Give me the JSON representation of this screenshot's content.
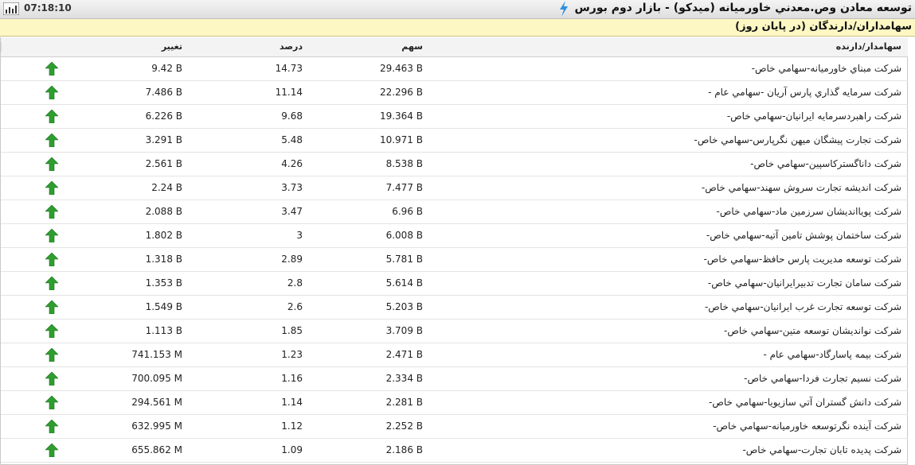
{
  "header": {
    "time": "07:18:10",
    "title": "توسعه معادن وص.معدني خاورميانه (ميدكو) - بازار دوم بورس",
    "icons": {
      "left": "bar-chart-icon",
      "title": "lightning-bolt-icon"
    }
  },
  "section": {
    "title": "سهامداران/دارندگان (در پایان روز)",
    "background": "#fdf7c3"
  },
  "table": {
    "columns": {
      "holder": "سهامدار/دارنده",
      "shares": "سهم",
      "percent": "درصد",
      "change": "تغییر"
    },
    "trend_color": "#2e9e2e",
    "rows": [
      {
        "holder": "شركت مبناي خاورميانه-سهامي خاص-",
        "shares": "29.463 B",
        "percent": "14.73",
        "change": "9.42 B",
        "trend": "up"
      },
      {
        "holder": "شركت سرمايه گذاري پارس آريان -سهامي عام -",
        "shares": "22.296 B",
        "percent": "11.14",
        "change": "7.486 B",
        "trend": "up"
      },
      {
        "holder": "شركت راهبردسرمايه ايرانيان-سهامي خاص-",
        "shares": "19.364 B",
        "percent": "9.68",
        "change": "6.226 B",
        "trend": "up"
      },
      {
        "holder": "شركت تجارت پيشگان ميهن نگرپارس-سهامي خاص-",
        "shares": "10.971 B",
        "percent": "5.48",
        "change": "3.291 B",
        "trend": "up"
      },
      {
        "holder": "شركت داناگستركاسپين-سهامي خاص-",
        "shares": "8.538 B",
        "percent": "4.26",
        "change": "2.561 B",
        "trend": "up"
      },
      {
        "holder": "شركت انديشه تجارت سروش سهند-سهامي خاص-",
        "shares": "7.477 B",
        "percent": "3.73",
        "change": "2.24 B",
        "trend": "up"
      },
      {
        "holder": "شركت پوياانديشان سرزمين ماد-سهامي خاص-",
        "shares": "6.96 B",
        "percent": "3.47",
        "change": "2.088 B",
        "trend": "up"
      },
      {
        "holder": "شركت ساختمان پوشش تامين آتيه-سهامي خاص-",
        "shares": "6.008 B",
        "percent": "3",
        "change": "1.802 B",
        "trend": "up"
      },
      {
        "holder": "شركت توسعه مديريت پارس حافظ-سهامي خاص-",
        "shares": "5.781 B",
        "percent": "2.89",
        "change": "1.318 B",
        "trend": "up"
      },
      {
        "holder": "شركت سامان تجارت تدبيرايرانيان-سهامي خاص-",
        "shares": "5.614 B",
        "percent": "2.8",
        "change": "1.353 B",
        "trend": "up"
      },
      {
        "holder": "شركت توسعه تجارت غرب ايرانيان-سهامي خاص-",
        "shares": "5.203 B",
        "percent": "2.6",
        "change": "1.549 B",
        "trend": "up"
      },
      {
        "holder": "شركت نوانديشان توسعه متين-سهامي خاص-",
        "shares": "3.709 B",
        "percent": "1.85",
        "change": "1.113 B",
        "trend": "up"
      },
      {
        "holder": "شركت بيمه پاسارگاد-سهامي عام -",
        "shares": "2.471 B",
        "percent": "1.23",
        "change": "741.153 M",
        "trend": "up"
      },
      {
        "holder": "شركت نسيم تجارت فردا-سهامي خاص-",
        "shares": "2.334 B",
        "percent": "1.16",
        "change": "700.095 M",
        "trend": "up"
      },
      {
        "holder": "شركت دانش گستران آتي سازيويا-سهامي خاص-",
        "shares": "2.281 B",
        "percent": "1.14",
        "change": "294.561 M",
        "trend": "up"
      },
      {
        "holder": "شركت آينده نگرتوسعه خاورميانه-سهامي خاص-",
        "shares": "2.252 B",
        "percent": "1.12",
        "change": "632.995 M",
        "trend": "up"
      },
      {
        "holder": "شركت پديده تابان تجارت-سهامي خاص-",
        "shares": "2.186 B",
        "percent": "1.09",
        "change": "655.862 M",
        "trend": "up"
      }
    ]
  }
}
